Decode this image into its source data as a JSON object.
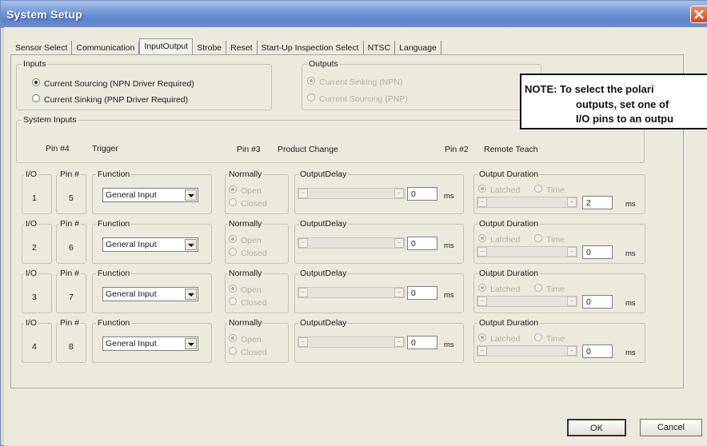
{
  "window": {
    "title": "System Setup"
  },
  "tabs": [
    "Sensor Select",
    "Communication",
    "InputOutput",
    "Strobe",
    "Reset",
    "Start-Up Inspection Select",
    "NTSC",
    "Language"
  ],
  "inputs": {
    "label": "Inputs",
    "option1": "Current Sourcing  (NPN Driver Required)",
    "option2": "Current Sinking    (PNP Driver Required)"
  },
  "outputs": {
    "label": "Outputs",
    "option1": "Current Sinking    (NPN)",
    "option2": "Current Sourcing  (PNP)"
  },
  "note": {
    "line1": "NOTE: To select the polari",
    "line2": "outputs, set one of",
    "line3": "I/O pins to an outpu"
  },
  "system_inputs": {
    "label": "System Inputs",
    "pin4": "Pin #4",
    "pin4_name": "Trigger",
    "pin3": "Pin #3",
    "pin3_name": "Product Change",
    "pin2": "Pin #2",
    "pin2_name": "Remote Teach"
  },
  "labels": {
    "io": "I/O",
    "pin": "Pin #",
    "function": "Function",
    "normally": "Normally",
    "open": "Open",
    "closed": "Closed",
    "output_delay": "OutputDelay",
    "ms": "ms",
    "output_duration": "Output Duration",
    "latched": "Latched",
    "time": "Time"
  },
  "io_rows": [
    {
      "io": "1",
      "pin": "5",
      "function": "General Input",
      "delay": "0",
      "duration": "2"
    },
    {
      "io": "2",
      "pin": "6",
      "function": "General Input",
      "delay": "0",
      "duration": "0"
    },
    {
      "io": "3",
      "pin": "7",
      "function": "General Input",
      "delay": "0",
      "duration": "0"
    },
    {
      "io": "4",
      "pin": "8",
      "function": "General Input",
      "delay": "0",
      "duration": "0"
    }
  ],
  "buttons": {
    "ok": "OK",
    "cancel": "Cancel"
  }
}
